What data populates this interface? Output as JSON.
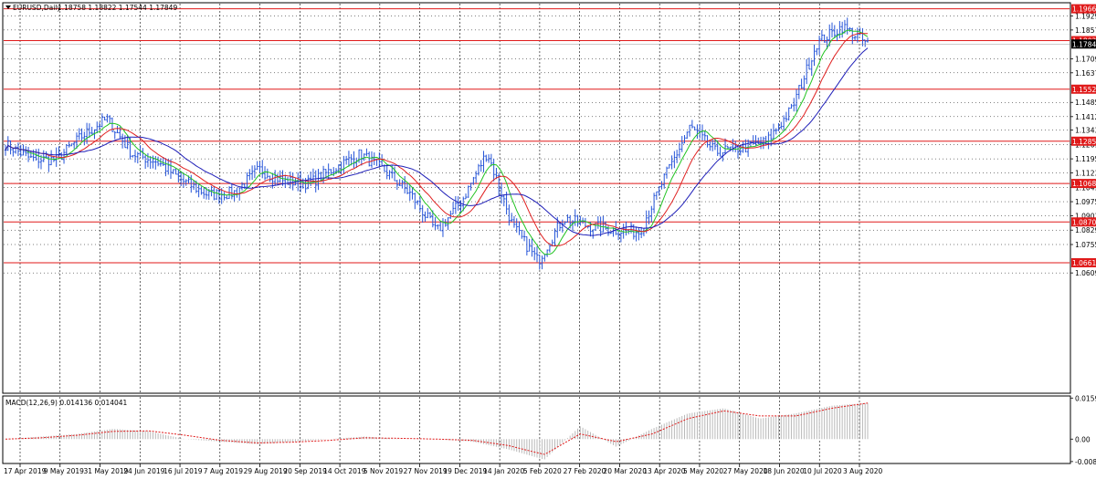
{
  "chart_header": {
    "symbol_label": "EURUSD,Daily",
    "ohlc": "1.18758 1.18822 1.17544 1.17849"
  },
  "indicator_header": {
    "label": "MACD(12,26,9) 0.014136 0.014041"
  },
  "colors": {
    "price": "#2554d8",
    "ma_fast": "#22c322",
    "ma_mid": "#e02020",
    "ma_slow": "#1f1fb8",
    "level": "#e01a1a",
    "macd_hist": "#b9b9b9",
    "macd_signal": "#e01a1a"
  },
  "chart_data": [
    {
      "type": "line",
      "title": "EURUSD,Daily",
      "x": [
        "17 Apr 2019",
        "9 May 2019",
        "31 May 2019",
        "24 Jun 2019",
        "16 Jul 2019",
        "7 Aug 2019",
        "29 Aug 2019",
        "20 Sep 2019",
        "14 Oct 2019",
        "5 Nov 2019",
        "27 Nov 2019",
        "19 Dec 2019",
        "14 Jan 2020",
        "5 Feb 2020",
        "27 Feb 2020",
        "20 Mar 2020",
        "13 Apr 2020",
        "5 May 2020",
        "27 May 2020",
        "18 Jun 2020",
        "10 Jul 2020",
        "3 Aug 2020"
      ],
      "series": [
        {
          "name": "EURUSD",
          "values": [
            1.127,
            1.1195,
            1.119,
            1.131,
            1.14,
            1.122,
            1.118,
            1.108,
            1.101,
            1.102,
            1.114,
            1.108,
            1.107,
            1.115,
            1.122,
            1.113,
            1.101,
            1.082,
            1.098,
            1.123,
            1.085,
            1.067,
            1.089,
            1.085,
            1.083,
            1.082,
            1.11,
            1.136,
            1.123,
            1.125,
            1.128,
            1.145,
            1.179,
            1.1875,
            1.1785
          ]
        }
      ],
      "ylim": [
        0.9991,
        1.1997
      ],
      "y_ticks": [
        "1.19290",
        "1.18570",
        "1.17849",
        "1.17090",
        "1.16370",
        "1.15529",
        "1.14850",
        "1.14120",
        "1.13430",
        "1.12857",
        "1.12690",
        "1.11950",
        "1.11230",
        "1.10685",
        "1.10490",
        "1.09750",
        "1.09030",
        "1.08709",
        "1.08290",
        "1.07550",
        "1.06614",
        "1.06090"
      ],
      "levels": [
        {
          "price": 1.1966,
          "label": "1.19660"
        },
        {
          "price": 1.18023,
          "label": "1.18023"
        },
        {
          "price": 1.15529,
          "label": "1.15529"
        },
        {
          "price": 1.12857,
          "label": "1.12857"
        },
        {
          "price": 1.10685,
          "label": "1.10685"
        },
        {
          "price": 1.08709,
          "label": "1.08709"
        },
        {
          "price": 1.06614,
          "label": "1.06614"
        }
      ],
      "current_price": {
        "price": 1.17849,
        "label": "1.17849"
      },
      "grid": true
    },
    {
      "type": "bar",
      "title": "MACD(12,26,9) 0.014136 0.014041",
      "series": [
        {
          "name": "MACD",
          "values": [
            0.0,
            0.001,
            0.002,
            0.004,
            0.003,
            0.0,
            -0.001,
            -0.002,
            -0.001,
            0.0,
            0.001,
            0.0,
            0.0,
            -0.001,
            -0.004,
            -0.008,
            0.005,
            -0.003,
            0.004,
            0.01,
            0.012,
            0.008,
            0.01,
            0.013,
            0.0141
          ]
        },
        {
          "name": "Signal",
          "values": [
            0.0,
            0.0005,
            0.0015,
            0.003,
            0.0032,
            0.0015,
            -0.0005,
            -0.0015,
            -0.0012,
            -0.0005,
            0.0005,
            0.0003,
            0.0,
            -0.0005,
            -0.0025,
            -0.006,
            0.002,
            -0.001,
            0.002,
            0.008,
            0.011,
            0.009,
            0.009,
            0.012,
            0.01404
          ]
        }
      ],
      "y_ticks": [
        "0.015992",
        "0.00",
        "-0.008749"
      ],
      "ylim": [
        -0.0095,
        0.0168
      ]
    }
  ]
}
